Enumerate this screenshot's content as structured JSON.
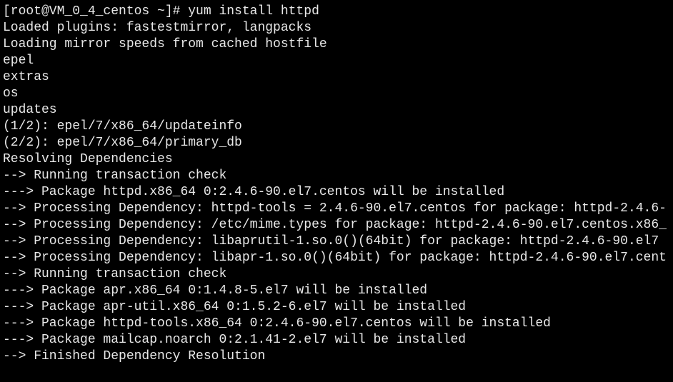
{
  "terminal": {
    "lines": [
      "[root@VM_0_4_centos ~]# yum install httpd",
      "Loaded plugins: fastestmirror, langpacks",
      "Loading mirror speeds from cached hostfile",
      "epel",
      "extras",
      "os",
      "updates",
      "(1/2): epel/7/x86_64/updateinfo",
      "(2/2): epel/7/x86_64/primary_db",
      "Resolving Dependencies",
      "--> Running transaction check",
      "---> Package httpd.x86_64 0:2.4.6-90.el7.centos will be installed",
      "--> Processing Dependency: httpd-tools = 2.4.6-90.el7.centos for package: httpd-2.4.6-",
      "--> Processing Dependency: /etc/mime.types for package: httpd-2.4.6-90.el7.centos.x86_",
      "--> Processing Dependency: libaprutil-1.so.0()(64bit) for package: httpd-2.4.6-90.el7",
      "--> Processing Dependency: libapr-1.so.0()(64bit) for package: httpd-2.4.6-90.el7.cent",
      "--> Running transaction check",
      "---> Package apr.x86_64 0:1.4.8-5.el7 will be installed",
      "---> Package apr-util.x86_64 0:1.5.2-6.el7 will be installed",
      "---> Package httpd-tools.x86_64 0:2.4.6-90.el7.centos will be installed",
      "---> Package mailcap.noarch 0:2.1.41-2.el7 will be installed",
      "--> Finished Dependency Resolution"
    ]
  }
}
